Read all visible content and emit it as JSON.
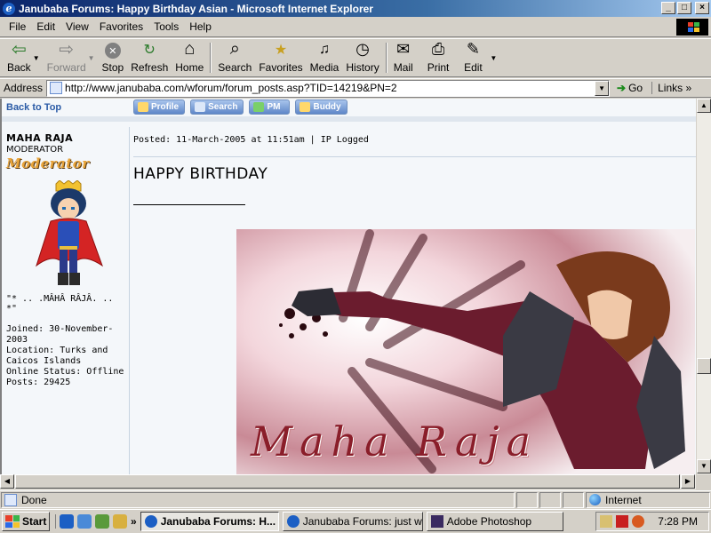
{
  "window": {
    "title": "Janubaba Forums: Happy Birthday Asian - Microsoft Internet Explorer",
    "min_glyph": "_",
    "max_glyph": "□",
    "close_glyph": "×"
  },
  "menu": {
    "items": [
      {
        "label": "File"
      },
      {
        "label": "Edit"
      },
      {
        "label": "View"
      },
      {
        "label": "Favorites"
      },
      {
        "label": "Tools"
      },
      {
        "label": "Help"
      }
    ]
  },
  "toolbar": {
    "back": {
      "label": "Back",
      "icon": "⇦"
    },
    "forward": {
      "label": "Forward",
      "icon": "⇨"
    },
    "stop": {
      "label": "Stop",
      "icon": "✕"
    },
    "refresh": {
      "label": "Refresh",
      "icon": "↻"
    },
    "home": {
      "label": "Home",
      "icon": "⌂"
    },
    "search": {
      "label": "Search",
      "icon": "⌕"
    },
    "favorites": {
      "label": "Favorites",
      "icon": "★"
    },
    "media": {
      "label": "Media",
      "icon": "♫"
    },
    "history": {
      "label": "History",
      "icon": "◷"
    },
    "mail": {
      "label": "Mail",
      "icon": "✉"
    },
    "print": {
      "label": "Print",
      "icon": "⎙"
    },
    "edit": {
      "label": "Edit",
      "icon": "✎"
    }
  },
  "address": {
    "label": "Address",
    "url": "http://www.janubaba.com/wforum/forum_posts.asp?TID=14219&PN=2",
    "go_label": "Go",
    "links_label": "Links"
  },
  "forum": {
    "back_to_top": "Back to Top",
    "buttons": {
      "profile": "Profile",
      "search": "Search",
      "pm": "PM",
      "buddy": "Buddy"
    },
    "author": {
      "name": "MAHA RAJA",
      "role": "MODERATOR",
      "rank_badge": "Moderator",
      "nickname": "\"* .. .MÂHÂ RÂJÂ. .. *\"",
      "joined": "Joined: 30-November-2003",
      "location": "Location: Turks and Caicos Islands",
      "online_status": "Online Status: Offline",
      "posts": "Posts: 29425"
    },
    "post": {
      "posted": "Posted: 11-March-2005 at 11:51am | IP Logged",
      "headline": "HAPPY BIRTHDAY",
      "image_caption": "Maha Raja"
    }
  },
  "scroll": {
    "up": "▲",
    "down": "▼",
    "left": "◀",
    "right": "▶"
  },
  "status": {
    "text": "Done",
    "zone": "Internet"
  },
  "taskbar": {
    "start_label": "Start",
    "overflow": "»",
    "tasks": [
      {
        "label": "Janubaba Forums: H..."
      },
      {
        "label": "Janubaba Forums: just wo..."
      },
      {
        "label": "Adobe Photoshop"
      }
    ],
    "clock": "7:28 PM"
  },
  "colors": {
    "title_gradient_start": "#0a246a",
    "link_blue": "#2b5ba6",
    "forum_bg": "#f4f7fa",
    "caption_red": "#8a1e2a"
  }
}
